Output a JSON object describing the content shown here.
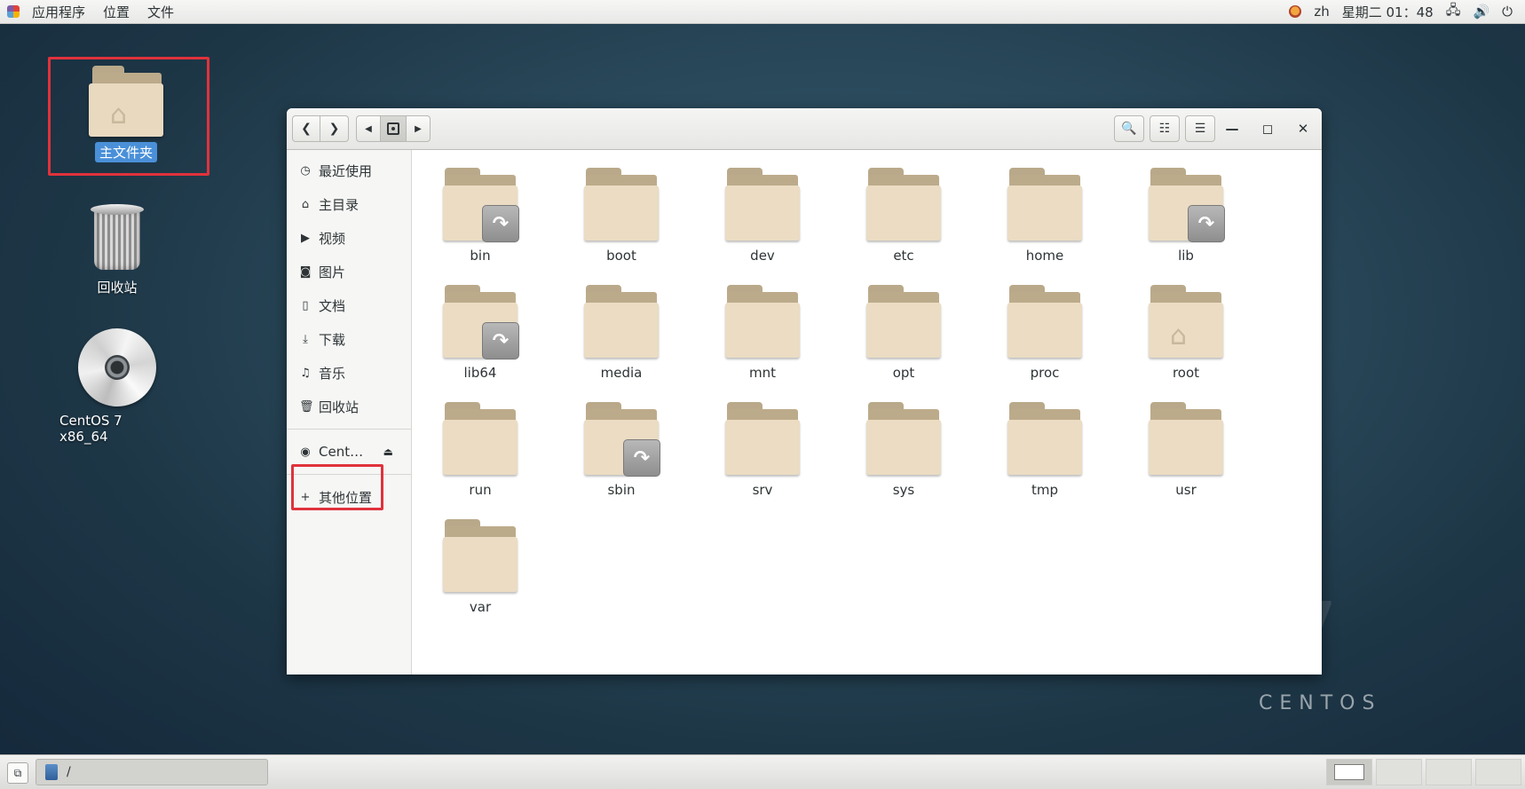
{
  "topbar": {
    "menus": [
      "应用程序",
      "位置",
      "文件"
    ],
    "lang": "zh",
    "datetime": "星期二 01：48"
  },
  "desktop": {
    "icons": [
      {
        "label": "主文件夹"
      },
      {
        "label": "回收站"
      },
      {
        "label": "CentOS 7 x86_64"
      }
    ],
    "watermark": "CENTOS",
    "watermark_digit": "7"
  },
  "window": {
    "sidebar": {
      "items": [
        {
          "label": "最近使用",
          "icon": "clock-icon"
        },
        {
          "label": "主目录",
          "icon": "home-icon"
        },
        {
          "label": "视频",
          "icon": "video-icon"
        },
        {
          "label": "图片",
          "icon": "camera-icon"
        },
        {
          "label": "文档",
          "icon": "document-icon"
        },
        {
          "label": "下载",
          "icon": "download-icon"
        },
        {
          "label": "音乐",
          "icon": "music-icon"
        },
        {
          "label": "回收站",
          "icon": "trash-icon"
        }
      ],
      "device": {
        "label": "Cent…",
        "icon": "disc-icon"
      },
      "other": {
        "label": "其他位置",
        "icon": "plus-icon"
      }
    },
    "folders": [
      {
        "name": "bin",
        "link": true
      },
      {
        "name": "boot"
      },
      {
        "name": "dev"
      },
      {
        "name": "etc"
      },
      {
        "name": "home"
      },
      {
        "name": "lib",
        "link": true
      },
      {
        "name": "lib64",
        "link": true
      },
      {
        "name": "media"
      },
      {
        "name": "mnt"
      },
      {
        "name": "opt"
      },
      {
        "name": "proc"
      },
      {
        "name": "root",
        "home": true
      },
      {
        "name": "run"
      },
      {
        "name": "sbin",
        "link": true
      },
      {
        "name": "srv"
      },
      {
        "name": "sys"
      },
      {
        "name": "tmp"
      },
      {
        "name": "usr"
      },
      {
        "name": "var"
      }
    ]
  },
  "taskbar": {
    "task_label": "/"
  }
}
